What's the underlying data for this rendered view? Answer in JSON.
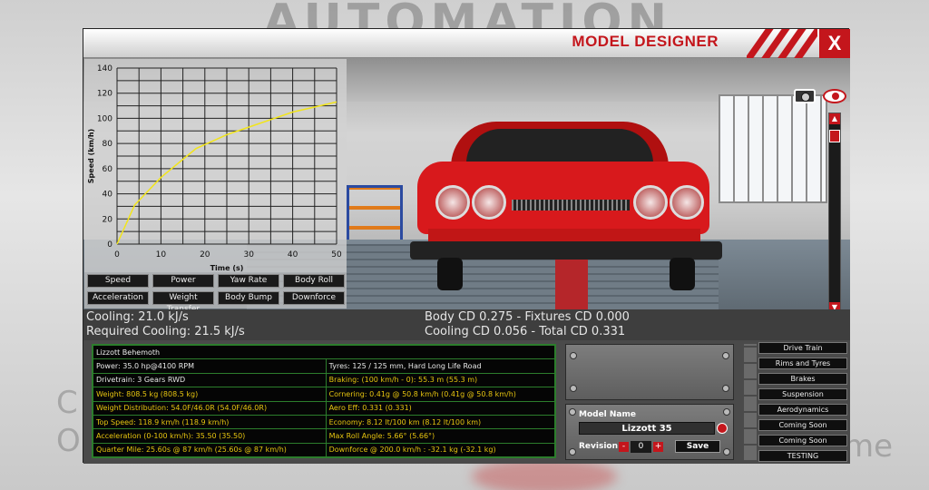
{
  "background": {
    "title": "AUTOMATION",
    "left_text_1": "C",
    "left_text_2": "O",
    "right_text": "me"
  },
  "window": {
    "title": "MODEL DESIGNER",
    "close_label": "X"
  },
  "chart_data": {
    "type": "line",
    "title": "",
    "xlabel": "Time (s)",
    "ylabel": "Speed (km/h)",
    "xlim": [
      0,
      50
    ],
    "ylim": [
      0,
      140
    ],
    "x_ticks": [
      "0",
      "10",
      "20",
      "30",
      "40",
      "50"
    ],
    "y_ticks": [
      "0",
      "20",
      "40",
      "60",
      "80",
      "100",
      "120",
      "140"
    ],
    "grid": true,
    "series": [
      {
        "color": "#f2e51a",
        "x": [
          0,
          4,
          10,
          18,
          25,
          30,
          40,
          50
        ],
        "y": [
          0,
          31,
          53,
          76,
          87,
          93,
          105,
          113
        ]
      }
    ]
  },
  "graph_buttons": [
    "Speed",
    "Power",
    "Yaw Rate",
    "Body Roll",
    "Acceleration",
    "Weight Transfer",
    "Body Bump",
    "Downforce"
  ],
  "info": {
    "cooling": "Cooling: 21.0 kJ/s",
    "required_cooling": "Required Cooling: 21.5 kJ/s",
    "body_cd": "Body CD 0.275 - Fixtures CD 0.000",
    "cooling_cd": "Cooling CD 0.056 - Total CD 0.331"
  },
  "stats": {
    "name": "Lizzott Behemoth",
    "rows": [
      [
        "Power: 35.0 hp@4100 RPM",
        "Tyres: 125 / 125 mm, Hard Long Life Road"
      ],
      [
        "Drivetrain: 3 Gears RWD",
        "Braking: (100 km/h - 0): 55.3 m (55.3 m)"
      ],
      [
        "Weight: 808.5 kg (808.5 kg)",
        "Cornering: 0.41g @ 50.8 km/h (0.41g @ 50.8 km/h)"
      ],
      [
        "Weight Distribution: 54.0F/46.0R (54.0F/46.0R)",
        "Aero Eff: 0.331 (0.331)"
      ],
      [
        "Top Speed: 118.9 km/h (118.9 km/h)",
        "Economy: 8.12 lt/100 km (8.12 lt/100 km)"
      ],
      [
        "Acceleration (0-100 km/h): 35.50 (35.50)",
        "Max Roll Angle: 5.66° (5.66°)"
      ],
      [
        "Quarter Mile: 25.60s @ 87 km/h (25.60s @ 87 km/h)",
        "Downforce @ 200.0 km/h : -32.1 kg (-32.1 kg)"
      ]
    ]
  },
  "model": {
    "label": "Model Name",
    "name": "Lizzott 35",
    "revision_label": "Revision",
    "revision_value": "0",
    "minus": "-",
    "plus": "+",
    "save_label": "Save"
  },
  "side_menu": [
    "Drive Train",
    "Rims and Tyres",
    "Brakes",
    "Suspension",
    "Aerodynamics",
    "Coming Soon",
    "Coming Soon",
    "TESTING"
  ],
  "colors": {
    "accent": "#c4161c",
    "stat_highlight": "#e6c410",
    "stat_border": "#2c7d2c"
  }
}
